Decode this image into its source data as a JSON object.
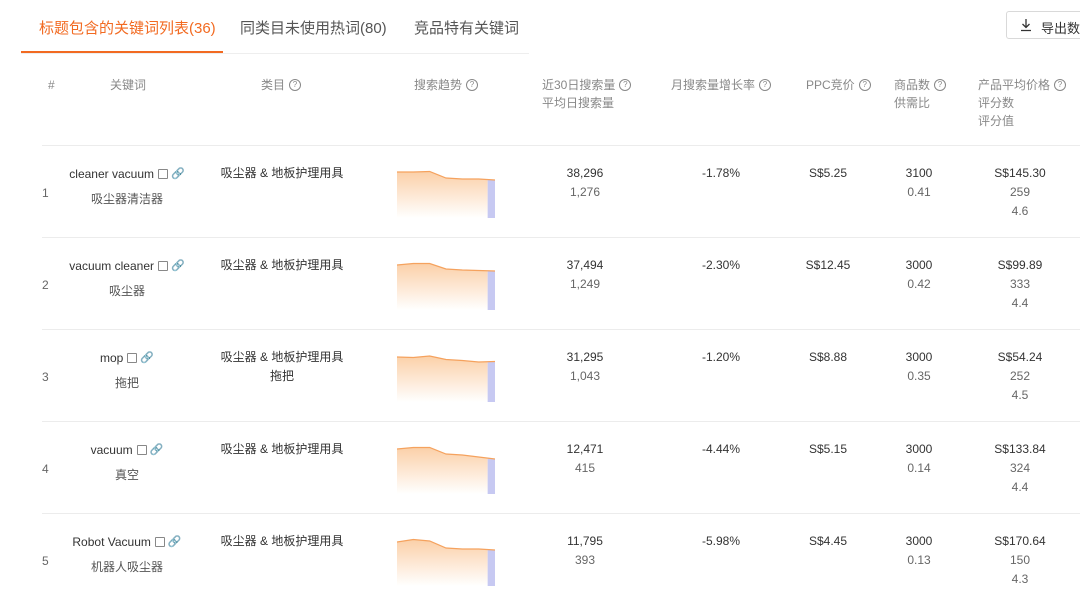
{
  "tabs": [
    {
      "label": "标题包含的关键词列表(36)",
      "active": true
    },
    {
      "label": "同类目未使用热词(80)",
      "active": false
    },
    {
      "label": "竞品特有关键词",
      "active": false
    }
  ],
  "export_label": "导出数据",
  "accent_color": "#f26a21",
  "columns": {
    "index": "#",
    "keyword": "关键词",
    "category": "类目",
    "trend": "搜索趋势",
    "search_volume_line1": "近30日搜索量",
    "search_volume_line2": "平均日搜索量",
    "growth": "月搜索量增长率",
    "ppc": "PPC竞价",
    "products_line1": "商品数",
    "products_line2": "供需比",
    "price_line1": "产品平均价格",
    "price_line2": "评分数",
    "price_line3": "评分值"
  },
  "rows": [
    {
      "index": "1",
      "keyword_en": "cleaner vacuum",
      "keyword_zh": "吸尘器清洁器",
      "category": "吸尘器 & 地板护理用具",
      "category_sub": "",
      "search_30d": "38,296",
      "search_daily": "1,276",
      "growth": "-1.78%",
      "ppc": "S$5.25",
      "products": "3100",
      "supply_ratio": "0.41",
      "avg_price": "S$145.30",
      "rating_count": "259",
      "rating": "4.6",
      "trend": [
        92,
        92,
        93,
        80,
        78,
        78,
        76
      ]
    },
    {
      "index": "2",
      "keyword_en": "vacuum cleaner",
      "keyword_zh": "吸尘器",
      "category": "吸尘器 & 地板护理用具",
      "category_sub": "",
      "search_30d": "37,494",
      "search_daily": "1,249",
      "growth": "-2.30%",
      "ppc": "S$12.45",
      "products": "3000",
      "supply_ratio": "0.42",
      "avg_price": "S$99.89",
      "rating_count": "333",
      "rating": "4.4",
      "trend": [
        90,
        93,
        93,
        82,
        80,
        79,
        78
      ]
    },
    {
      "index": "3",
      "keyword_en": "mop",
      "keyword_zh": "拖把",
      "category": "吸尘器 & 地板护理用具",
      "category_sub": "拖把",
      "search_30d": "31,295",
      "search_daily": "1,043",
      "growth": "-1.20%",
      "ppc": "S$8.88",
      "products": "3000",
      "supply_ratio": "0.35",
      "avg_price": "S$54.24",
      "rating_count": "252",
      "rating": "4.5",
      "trend": [
        90,
        89,
        92,
        85,
        83,
        80,
        81
      ]
    },
    {
      "index": "4",
      "keyword_en": "vacuum",
      "keyword_zh": "真空",
      "category": "吸尘器 & 地板护理用具",
      "category_sub": "",
      "search_30d": "12,471",
      "search_daily": "415",
      "growth": "-4.44%",
      "ppc": "S$5.15",
      "products": "3000",
      "supply_ratio": "0.14",
      "avg_price": "S$133.84",
      "rating_count": "324",
      "rating": "4.4",
      "trend": [
        90,
        93,
        93,
        80,
        78,
        74,
        70
      ]
    },
    {
      "index": "5",
      "keyword_en": "Robot Vacuum",
      "keyword_zh": "机器人吸尘器",
      "category": "吸尘器 & 地板护理用具",
      "category_sub": "",
      "search_30d": "11,795",
      "search_daily": "393",
      "growth": "-5.98%",
      "ppc": "S$4.45",
      "products": "3000",
      "supply_ratio": "0.13",
      "avg_price": "S$170.64",
      "rating_count": "150",
      "rating": "4.3",
      "trend": [
        88,
        93,
        90,
        76,
        74,
        74,
        72
      ]
    }
  ]
}
